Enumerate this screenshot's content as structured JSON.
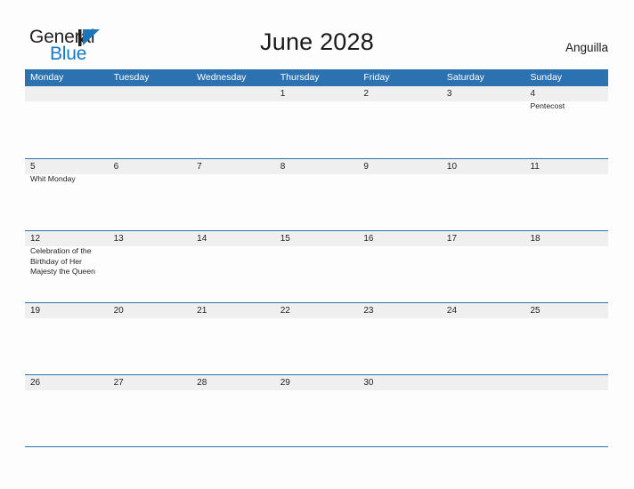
{
  "logo": {
    "word1": "General",
    "word2": "Blue",
    "mark": "triangle-icon",
    "dark_color": "#231f20",
    "blue_color": "#1479c4"
  },
  "header": {
    "title": "June 2028",
    "locale": "Anguilla"
  },
  "colors": {
    "header_blue": "#2c72b0",
    "band_gray": "#efefef",
    "page_bg": "#fdfdfd",
    "text": "#231f20"
  },
  "calendar": {
    "weekdays": [
      "Monday",
      "Tuesday",
      "Wednesday",
      "Thursday",
      "Friday",
      "Saturday",
      "Sunday"
    ],
    "weeks": [
      {
        "days": [
          {
            "num": "",
            "events": []
          },
          {
            "num": "",
            "events": []
          },
          {
            "num": "",
            "events": []
          },
          {
            "num": "1",
            "events": []
          },
          {
            "num": "2",
            "events": []
          },
          {
            "num": "3",
            "events": []
          },
          {
            "num": "4",
            "events": [
              "Pentecost"
            ]
          }
        ]
      },
      {
        "days": [
          {
            "num": "5",
            "events": [
              "Whit Monday"
            ]
          },
          {
            "num": "6",
            "events": []
          },
          {
            "num": "7",
            "events": []
          },
          {
            "num": "8",
            "events": []
          },
          {
            "num": "9",
            "events": []
          },
          {
            "num": "10",
            "events": []
          },
          {
            "num": "11",
            "events": []
          }
        ]
      },
      {
        "days": [
          {
            "num": "12",
            "events": [
              "Celebration of the Birthday of Her Majesty the Queen"
            ]
          },
          {
            "num": "13",
            "events": []
          },
          {
            "num": "14",
            "events": []
          },
          {
            "num": "15",
            "events": []
          },
          {
            "num": "16",
            "events": []
          },
          {
            "num": "17",
            "events": []
          },
          {
            "num": "18",
            "events": []
          }
        ]
      },
      {
        "days": [
          {
            "num": "19",
            "events": []
          },
          {
            "num": "20",
            "events": []
          },
          {
            "num": "21",
            "events": []
          },
          {
            "num": "22",
            "events": []
          },
          {
            "num": "23",
            "events": []
          },
          {
            "num": "24",
            "events": []
          },
          {
            "num": "25",
            "events": []
          }
        ]
      },
      {
        "days": [
          {
            "num": "26",
            "events": []
          },
          {
            "num": "27",
            "events": []
          },
          {
            "num": "28",
            "events": []
          },
          {
            "num": "29",
            "events": []
          },
          {
            "num": "30",
            "events": []
          },
          {
            "num": "",
            "events": []
          },
          {
            "num": "",
            "events": []
          }
        ]
      }
    ]
  }
}
